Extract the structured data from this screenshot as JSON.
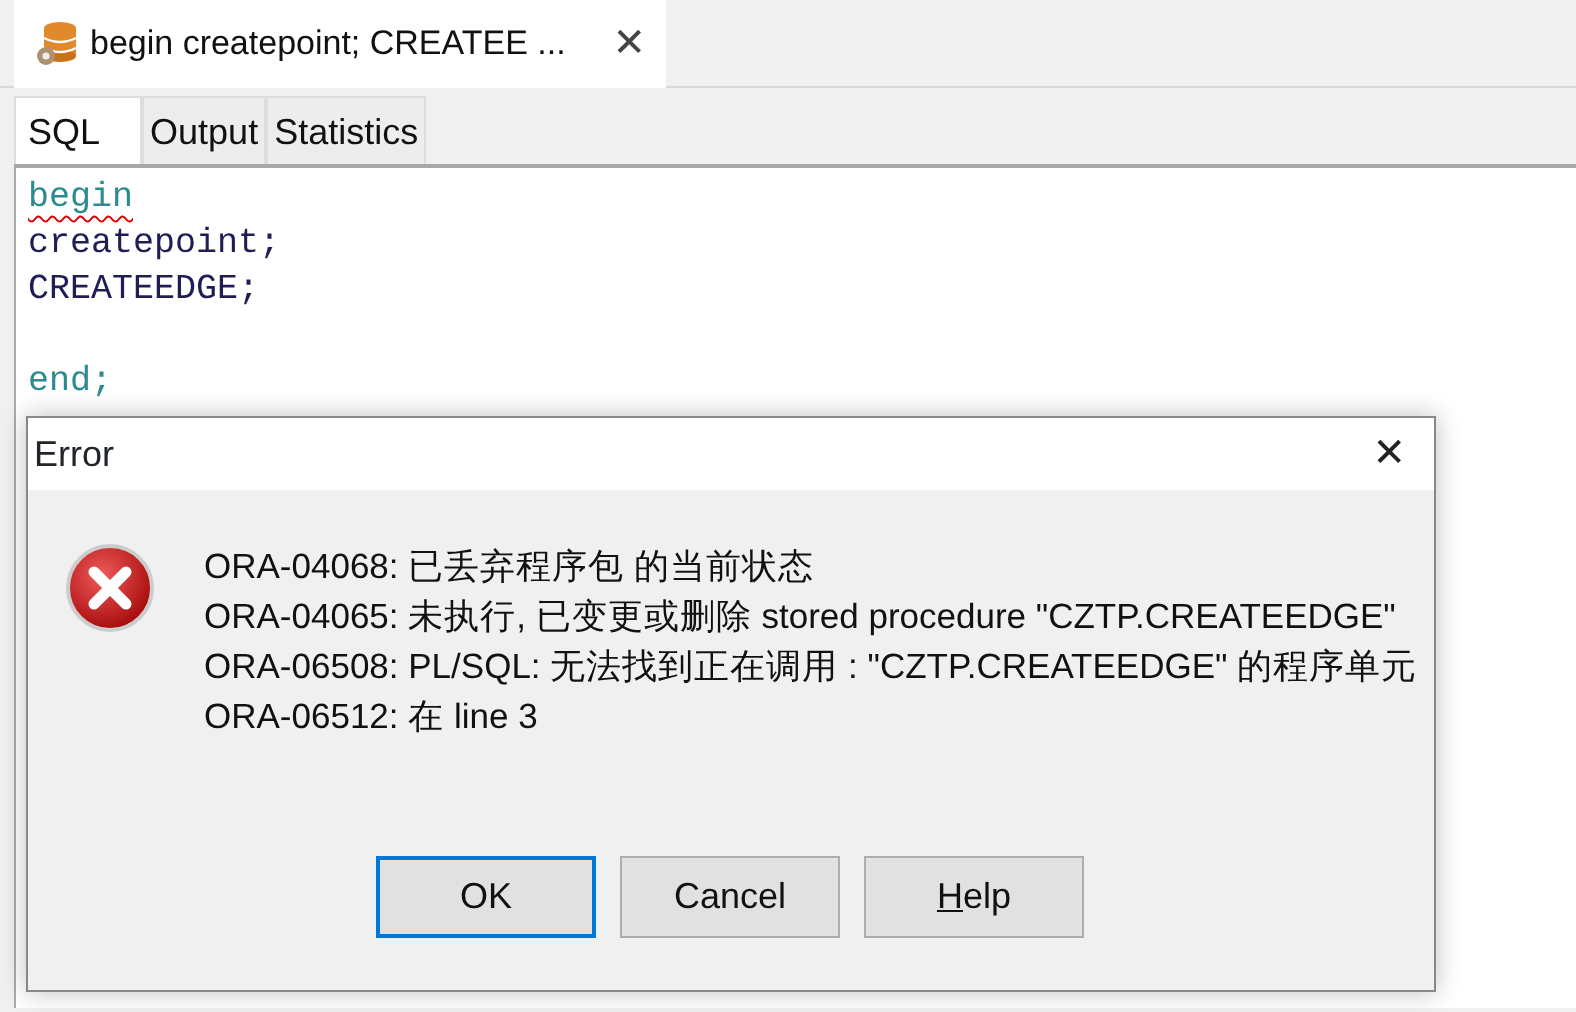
{
  "document_tab": {
    "title": "begin createpoint; CREATEE ...",
    "close": "✕"
  },
  "tabs": [
    {
      "label": "SQL",
      "selected": true
    },
    {
      "label": "Output",
      "selected": false
    },
    {
      "label": "Statistics",
      "selected": false
    }
  ],
  "editor": {
    "lines": [
      {
        "text": "begin",
        "kind": "keyword",
        "misspelled": true
      },
      {
        "text": "createpoint;",
        "kind": "identifier",
        "misspelled": false
      },
      {
        "text": "CREATEEDGE;",
        "kind": "identifier",
        "misspelled": false
      },
      {
        "kind": "blank"
      },
      {
        "text": "end;",
        "kind": "keyword",
        "misspelled": false
      }
    ]
  },
  "dialog": {
    "title": "Error",
    "close": "✕",
    "messages": [
      "ORA-04068: 已丢弃程序包  的当前状态",
      "ORA-04065: 未执行, 已变更或删除 stored procedure \"CZTP.CREATEEDGE\"",
      "ORA-06508: PL/SQL: 无法找到正在调用 : \"CZTP.CREATEEDGE\" 的程序单元",
      "ORA-06512: 在 line 3"
    ],
    "buttons": [
      {
        "label": "OK",
        "default": true,
        "access_key": false
      },
      {
        "label": "Cancel",
        "default": false,
        "access_key": false
      },
      {
        "label": "Help",
        "default": false,
        "access_key": true
      }
    ]
  }
}
